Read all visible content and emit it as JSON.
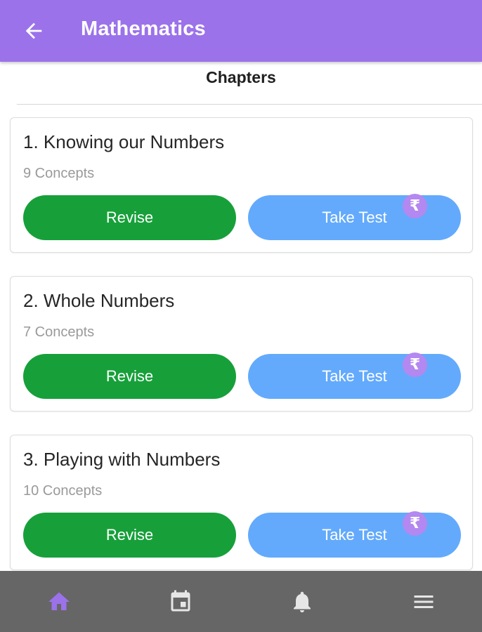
{
  "header": {
    "title": "Mathematics",
    "back_icon": "arrow-back-icon"
  },
  "section": {
    "title": "Chapters"
  },
  "chapters": [
    {
      "title": "1. Knowing our Numbers",
      "concepts": "9 Concepts",
      "revise_label": "Revise",
      "test_label": "Take Test",
      "badge": "₹"
    },
    {
      "title": "2. Whole Numbers",
      "concepts": "7 Concepts",
      "revise_label": "Revise",
      "test_label": "Take Test",
      "badge": "₹"
    },
    {
      "title": "3. Playing with Numbers",
      "concepts": "10 Concepts",
      "revise_label": "Revise",
      "test_label": "Take Test",
      "badge": "₹"
    }
  ],
  "bottom_nav": {
    "items": [
      {
        "icon": "home-icon",
        "active": true
      },
      {
        "icon": "calendar-icon",
        "active": false
      },
      {
        "icon": "bell-icon",
        "active": false
      },
      {
        "icon": "menu-icon",
        "active": false
      }
    ]
  },
  "colors": {
    "app_bar": "#9b72ea",
    "revise": "#17a03a",
    "take_test": "#63aafc",
    "badge": "#b388f0",
    "nav_bg": "#666666",
    "nav_active": "#9b72ea",
    "nav_inactive": "#e6e6e6"
  }
}
